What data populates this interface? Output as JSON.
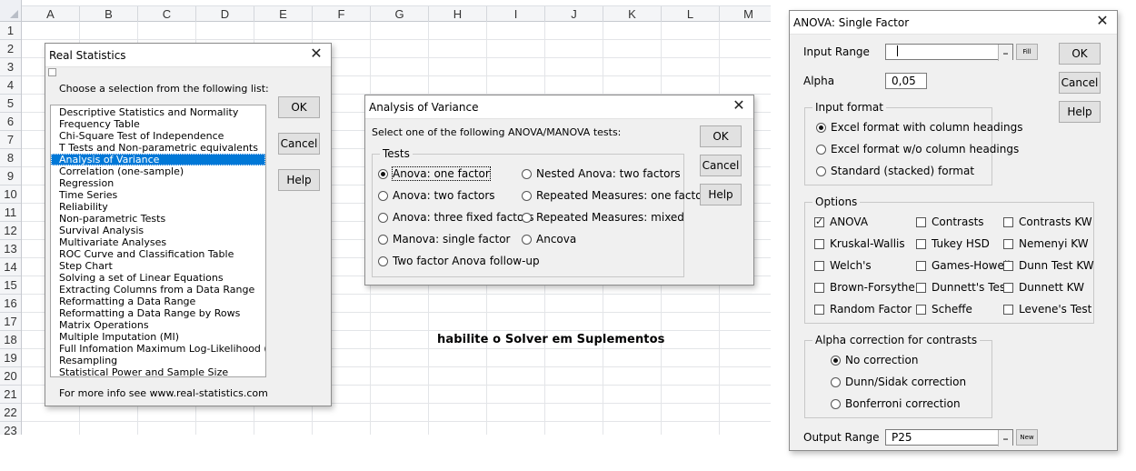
{
  "sheet": {
    "columns": [
      "A",
      "B",
      "C",
      "D",
      "E",
      "F",
      "G",
      "H",
      "I",
      "J",
      "K",
      "L",
      "M"
    ],
    "rows": [
      "1",
      "2",
      "3",
      "4",
      "5",
      "6",
      "7",
      "8",
      "9",
      "10",
      "11",
      "12",
      "13",
      "14",
      "15",
      "16",
      "17",
      "18",
      "19",
      "20",
      "21",
      "22",
      "23"
    ],
    "note": "habilite o Solver em Suplementos"
  },
  "real_statistics": {
    "title": "Real Statistics",
    "prompt": "Choose a selection from the following list:",
    "items": [
      "Descriptive Statistics and Normality",
      "Frequency Table",
      "Chi-Square Test of Independence",
      "T Tests and Non-parametric equivalents",
      "Analysis of Variance",
      "Correlation (one-sample)",
      "Regression",
      "Time Series",
      "Reliability",
      "Non-parametric Tests",
      "Survival Analysis",
      "Multivariate Analyses",
      "ROC Curve and Classification Table",
      "Step Chart",
      "Solving a set of Linear Equations",
      "Extracting Columns from a Data Range",
      "Reformatting a Data Range",
      "Reformatting a Data Range by Rows",
      "Matrix Operations",
      "Multiple Imputation (MI)",
      "Full Infomation Maximum Log-Likelihood (FIML)",
      "Resampling",
      "Statistical Power and Sample Size"
    ],
    "selected_index": 4,
    "footer": "For more info see www.real-statistics.com",
    "ok": "OK",
    "cancel": "Cancel",
    "help": "Help"
  },
  "anova_menu": {
    "title": "Analysis of Variance",
    "prompt": "Select one of the following ANOVA/MANOVA tests:",
    "group": "Tests",
    "left_options": [
      "Anova: one factor",
      "Anova: two factors",
      "Anova: three fixed factors",
      "Manova: single factor",
      "Two factor Anova follow-up"
    ],
    "right_options": [
      "Nested Anova: two factors",
      "Repeated Measures: one factor",
      "Repeated Measures: mixed",
      "Ancova"
    ],
    "ok": "OK",
    "cancel": "Cancel",
    "help": "Help"
  },
  "single_factor": {
    "title": "ANOVA: Single Factor",
    "input_range_label": "Input Range",
    "input_range_value": "",
    "fill": "Fill",
    "alpha_label": "Alpha",
    "alpha_value": "0,05",
    "ok": "OK",
    "cancel": "Cancel",
    "help": "Help",
    "input_format": {
      "title": "Input format",
      "options": [
        "Excel format with column headings",
        "Excel format w/o column headings",
        "Standard (stacked) format"
      ]
    },
    "options": {
      "title": "Options",
      "col1": [
        "ANOVA",
        "Kruskal-Wallis",
        "Welch's",
        "Brown-Forsythe",
        "Random Factor"
      ],
      "col2": [
        "Contrasts",
        "Tukey HSD",
        "Games-Howell",
        "Dunnett's Test",
        "Scheffe"
      ],
      "col3": [
        "Contrasts KW",
        "Nemenyi KW",
        "Dunn Test KW",
        "Dunnett KW",
        "Levene's Test"
      ]
    },
    "alpha_correction": {
      "title": "Alpha correction for contrasts",
      "options": [
        "No correction",
        "Dunn/Sidak correction",
        "Bonferroni correction"
      ]
    },
    "output_range_label": "Output Range",
    "output_range_value": "P25",
    "new": "New"
  }
}
